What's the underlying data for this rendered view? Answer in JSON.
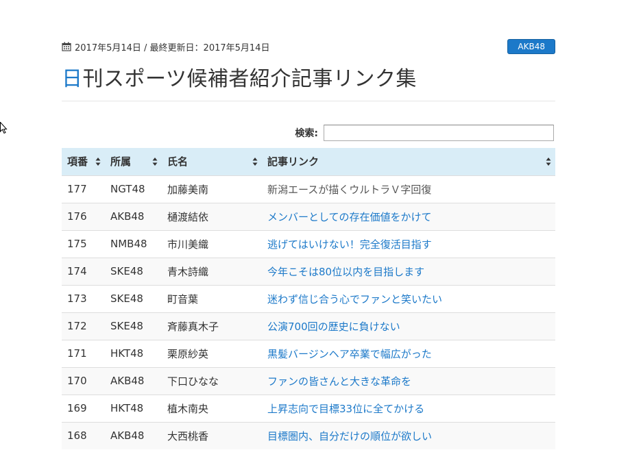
{
  "post": {
    "date_text": "2017年5月14日 / 最終更新日：2017年5月14日",
    "tag": "AKB48",
    "title_first": "日",
    "title_rest": "刊スポーツ候補者紹介記事リンク集"
  },
  "search": {
    "label": "検索:",
    "value": ""
  },
  "table": {
    "headers": [
      "項番",
      "所属",
      "氏名",
      "記事リンク"
    ],
    "rows": [
      {
        "no": "177",
        "group": "NGT48",
        "name": "加藤美南",
        "link": "新潟エースが描くウルトラＶ字回復"
      },
      {
        "no": "176",
        "group": "AKB48",
        "name": "樋渡結依",
        "link": "メンバーとしての存在価値をかけて"
      },
      {
        "no": "175",
        "group": "NMB48",
        "name": "市川美織",
        "link": "逃げてはいけない！完全復活目指す"
      },
      {
        "no": "174",
        "group": "SKE48",
        "name": "青木詩織",
        "link": "今年こそは80位以内を目指します"
      },
      {
        "no": "173",
        "group": "SKE48",
        "name": "町音葉",
        "link": "迷わず信じ合う心でファンと笑いたい"
      },
      {
        "no": "172",
        "group": "SKE48",
        "name": "斉藤真木子",
        "link": "公演700回の歴史に負けない"
      },
      {
        "no": "171",
        "group": "HKT48",
        "name": "栗原紗英",
        "link": "黒髪バージンヘア卒業で幅広がった"
      },
      {
        "no": "170",
        "group": "AKB48",
        "name": "下口ひなな",
        "link": "ファンの皆さんと大きな革命を"
      },
      {
        "no": "169",
        "group": "HKT48",
        "name": "植木南央",
        "link": "上昇志向で目標33位に全てかける"
      },
      {
        "no": "168",
        "group": "AKB48",
        "name": "大西桃香",
        "link": "目標圏内、自分だけの順位が欲しい"
      }
    ]
  },
  "colors": {
    "accent": "#1c79c9",
    "header_bg": "#d9edf7"
  }
}
